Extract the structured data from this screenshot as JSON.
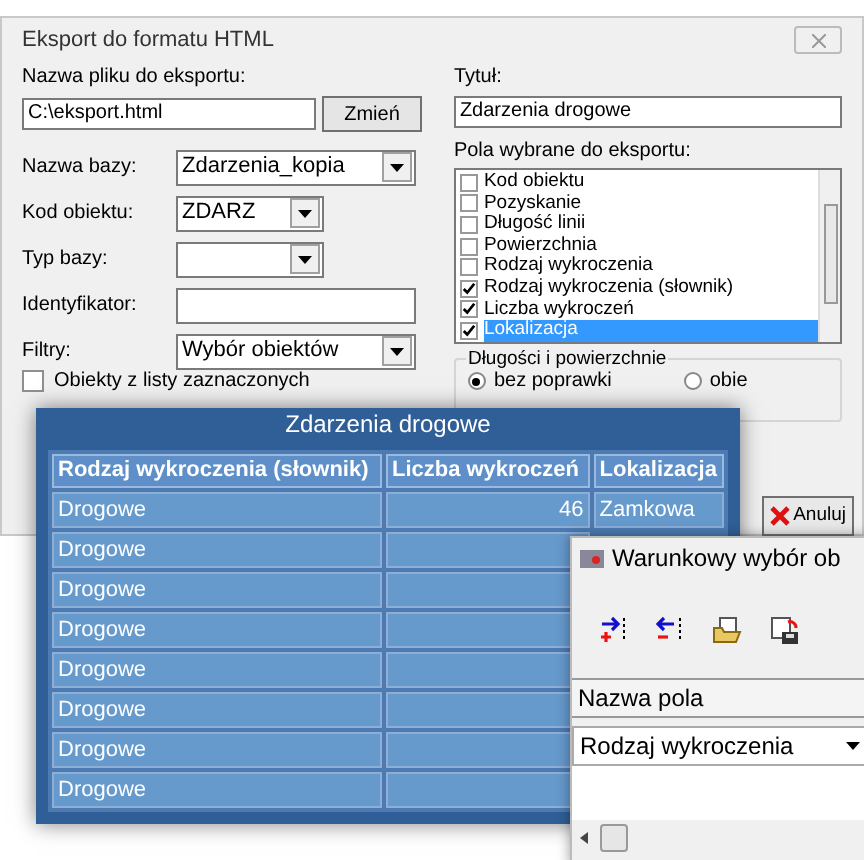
{
  "export_dialog": {
    "title": "Eksport do formatu HTML",
    "file_label": "Nazwa pliku do eksportu:",
    "file_value": "C:\\eksport.html",
    "change_button": "Zmień",
    "fields": [
      {
        "kind": "select",
        "label": "Nazwa bazy:",
        "value": "Zdarzenia_kopia"
      },
      {
        "kind": "select",
        "label": "Kod obiektu:",
        "value": "ZDARZ"
      },
      {
        "kind": "select",
        "label": "Typ bazy:"
      },
      {
        "kind": "input",
        "label": "Identyfikator:"
      },
      {
        "kind": "select",
        "label": "Filtry:",
        "value": "Wybór obiektów"
      }
    ],
    "objects_checkbox": {
      "label": "Obiekty z listy zaznaczonych",
      "checked": false
    },
    "title_label": "Tytuł:",
    "title_value": "Zdarzenia drogowe",
    "fields_label": "Pola wybrane do eksportu:",
    "export_fields": [
      {
        "label": "Kod obiektu",
        "checked": false,
        "selected": false
      },
      {
        "label": "Pozyskanie",
        "checked": false,
        "selected": false
      },
      {
        "label": "Długość linii",
        "checked": false,
        "selected": false
      },
      {
        "label": "Powierzchnia",
        "checked": false,
        "selected": false
      },
      {
        "label": "Rodzaj wykroczenia",
        "checked": false,
        "selected": false
      },
      {
        "label": "Rodzaj wykroczenia (słownik)",
        "checked": true,
        "selected": false
      },
      {
        "label": "Liczba wykroczeń",
        "checked": true,
        "selected": false
      },
      {
        "label": "Lokalizacja",
        "checked": true,
        "selected": true
      }
    ],
    "length_group": {
      "title": "Długości i powierzchnie",
      "options": [
        {
          "label": "bez poprawki",
          "selected": true
        },
        {
          "label": "obie",
          "selected": false
        }
      ]
    },
    "cancel_button": "Anuluj"
  },
  "results_window": {
    "title": "Zdarzenia drogowe",
    "columns": [
      "Rodzaj wykroczenia (słownik)",
      "Liczba wykroczeń",
      "Lokalizacja"
    ],
    "rows": [
      {
        "cells": [
          "Drogowe",
          "46",
          "Zamkowa"
        ]
      },
      {
        "cells": [
          "Drogowe"
        ]
      },
      {
        "cells": [
          "Drogowe"
        ]
      },
      {
        "cells": [
          "Drogowe"
        ]
      },
      {
        "cells": [
          "Drogowe"
        ]
      },
      {
        "cells": [
          "Drogowe"
        ]
      },
      {
        "cells": [
          "Drogowe"
        ]
      },
      {
        "cells": [
          "Drogowe"
        ]
      }
    ]
  },
  "filter_window": {
    "title": "Warunkowy wybór ob",
    "column_header": "Nazwa pola",
    "field_value": "Rodzaj wykroczenia"
  }
}
